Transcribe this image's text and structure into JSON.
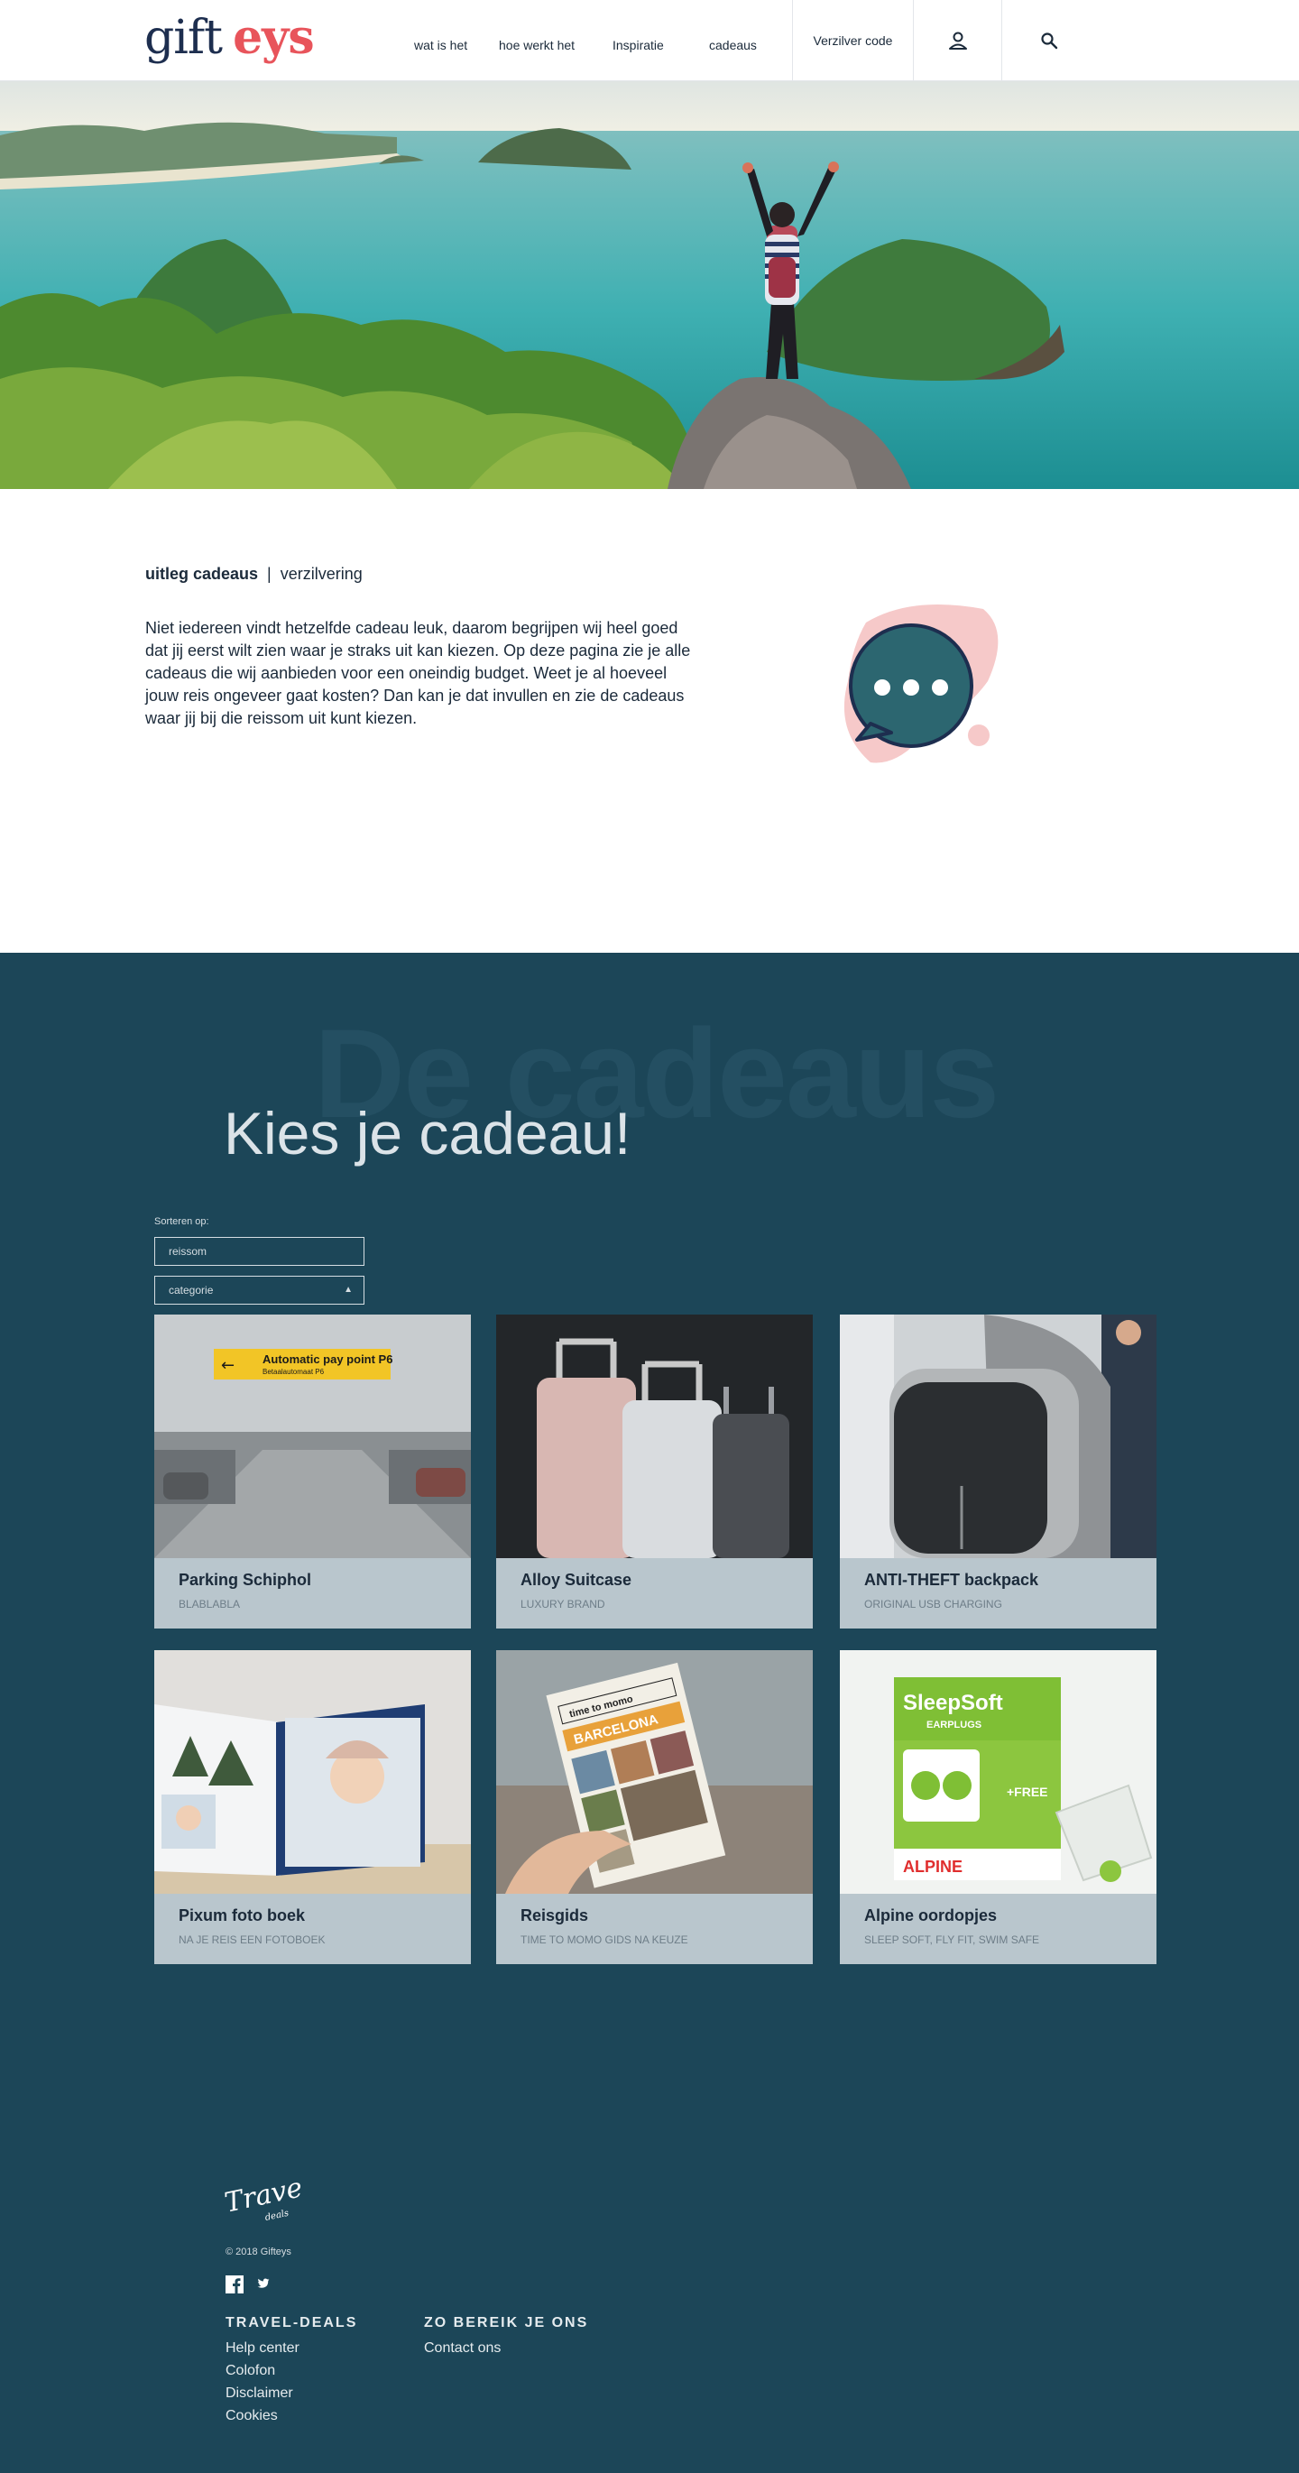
{
  "header": {
    "logo_part1": "gift",
    "logo_part2": "eys",
    "nav": [
      "wat is het",
      "hoe werkt het",
      "Inspiratie",
      "cadeaus"
    ],
    "redeem_label": "Verzilver code"
  },
  "intro": {
    "tab_active": "uitleg cadeaus",
    "tab_separator": "|",
    "tab_other": "verzilvering",
    "text": "Niet iedereen vindt hetzelfde cadeau leuk, daarom begrijpen wij heel goed dat jij eerst wilt zien waar je straks uit kan kiezen. Op deze pagina zie je alle cadeaus die wij aanbieden voor een oneindig budget. Weet je al hoeveel jouw reis ongeveer gaat kosten? Dan kan je dat invullen en zie de cadeaus waar jij bij die reissom uit kunt kiezen."
  },
  "gifts": {
    "background_word": "De cadeaus",
    "title": "Kies je cadeau!",
    "sort_label": "Sorteren op:",
    "filter_reissom": "reissom",
    "filter_category": "categorie",
    "cards": [
      {
        "title": "Parking Schiphol",
        "subtitle": "BLABLABLA"
      },
      {
        "title": "Alloy Suitcase",
        "subtitle": "LUXURY BRAND"
      },
      {
        "title": "ANTI-THEFT backpack",
        "subtitle": "ORIGINAL USB CHARGING"
      },
      {
        "title": "Pixum foto boek",
        "subtitle": "NA JE REIS EEN FOTOBOEK"
      },
      {
        "title": "Reisgids",
        "subtitle": "TIME TO MOMO GIDS NA KEUZE"
      },
      {
        "title": "Alpine oordopjes",
        "subtitle": "SLEEP SOFT, FLY FIT, SWIM SAFE"
      }
    ]
  },
  "images": {
    "parking_sign": "Automatic pay point P6",
    "parking_sign_sub": "Betaalautomaat P6",
    "guide_top": "time to momo",
    "guide_city": "BARCELONA",
    "earplug_brand": "SleepSoft",
    "earplug_type": "EARPLUGS",
    "earplug_promo": "+FREE",
    "earplug_maker": "ALPINE"
  },
  "footer": {
    "logo_text": "Travel",
    "logo_sub": "deals",
    "copyright": "© 2018 Gifteys",
    "col1_title": "TRAVEL-DEALS",
    "col1_links": [
      "Help center",
      "Colofon",
      "Disclaimer",
      "Cookies"
    ],
    "col2_title": "ZO BEREIK JE ONS",
    "col2_links": [
      "Contact ons"
    ]
  },
  "colors": {
    "navy": "#1d2e4f",
    "accent_red": "#e8545b",
    "section_teal": "#1c4658",
    "card_bg": "#b9c6cd",
    "chat_bubble": "#2c6670",
    "chat_blob": "#f6c9c9"
  },
  "icons": [
    "user-icon",
    "search-icon",
    "facebook-icon",
    "twitter-icon",
    "chevron-up-icon",
    "chat-bubble-icon"
  ]
}
